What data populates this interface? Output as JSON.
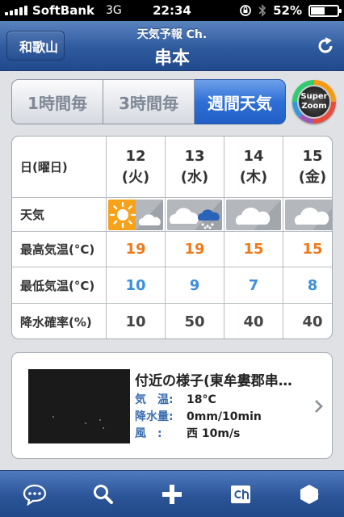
{
  "status_bar": {
    "carrier": "SoftBank",
    "network": "3G",
    "time": "22:34",
    "battery": "52%",
    "battery_level": 0.52
  },
  "nav": {
    "back_label": "和歌山",
    "subtitle": "天気予報 Ch.",
    "title": "串本"
  },
  "segments": [
    {
      "label": "1時間毎",
      "active": false
    },
    {
      "label": "3時間毎",
      "active": false
    },
    {
      "label": "週間天気",
      "active": true
    }
  ],
  "super_zoom": {
    "line1": "Super",
    "line2": "Zoom"
  },
  "table": {
    "row_headers": {
      "day": "日(曜日)",
      "weather": "天気",
      "high": "最高気温(°C)",
      "low": "最低気温(°C)",
      "rain": "降水確率(%)"
    },
    "days": [
      {
        "date": "12",
        "weekday": "(火)",
        "weather": "sunny-then-cloudy",
        "high": "19",
        "low": "10",
        "rain": "10"
      },
      {
        "date": "13",
        "weekday": "(水)",
        "weather": "cloudy-then-snow",
        "high": "19",
        "low": "9",
        "rain": "50"
      },
      {
        "date": "14",
        "weekday": "(木)",
        "weather": "cloudy",
        "high": "15",
        "low": "7",
        "rain": "40"
      },
      {
        "date": "15",
        "weekday": "(金)",
        "weather": "cloudy",
        "high": "15",
        "low": "8",
        "rain": "40"
      }
    ]
  },
  "nearby": {
    "title": "付近の様子(東牟婁郡串…",
    "temp_label": "気　温:",
    "temp_value": "18°C",
    "precip_label": "降水量:",
    "precip_value": "0mm/10min",
    "wind_label": "風　:",
    "wind_value": "西 10m/s"
  },
  "tabbar": {
    "icons": [
      "chat-bubble-icon",
      "search-icon",
      "plus-icon",
      "channel-icon",
      "settings-hexagon-icon"
    ]
  },
  "colors": {
    "high_temp": "#f07a1a",
    "low_temp": "#3d8fd9",
    "nav_blue": "#2e5a9e",
    "active_segment": "#2e6fd7"
  }
}
